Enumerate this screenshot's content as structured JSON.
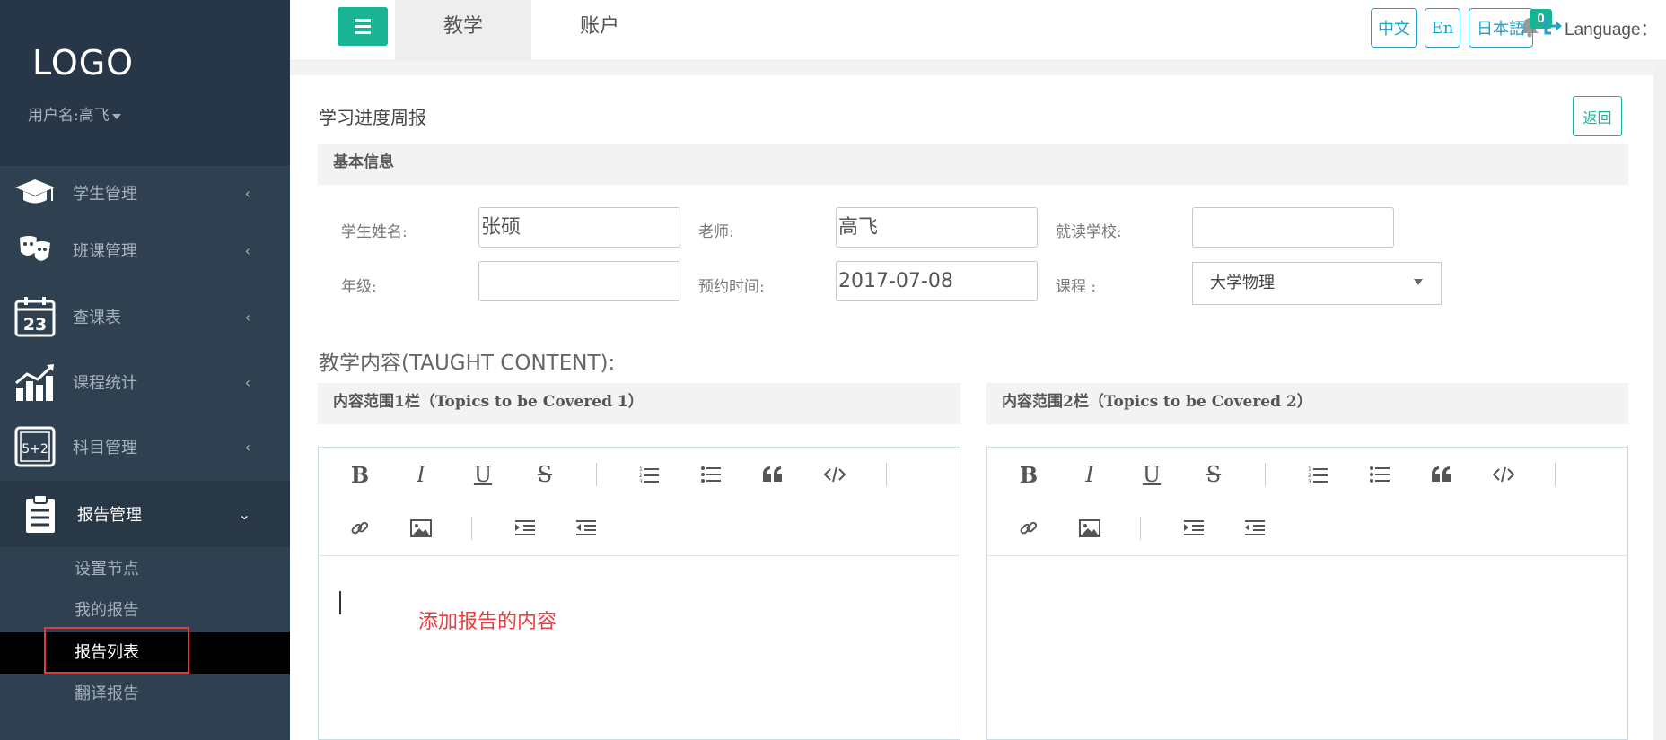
{
  "sidebar": {
    "logo": "LOGO",
    "username": "用户名:高飞",
    "items": [
      {
        "label": "学生管理",
        "icon": "graduation-cap-icon"
      },
      {
        "label": "班课管理",
        "icon": "theater-masks-icon"
      },
      {
        "label": "查课表",
        "icon": "calendar-23-icon"
      },
      {
        "label": "课程统计",
        "icon": "bar-chart-icon"
      },
      {
        "label": "科目管理",
        "icon": "chalkboard-icon"
      },
      {
        "label": "报告管理",
        "icon": "clipboard-icon"
      }
    ],
    "subitems": [
      {
        "label": "设置节点"
      },
      {
        "label": "我的报告"
      },
      {
        "label": "报告列表"
      },
      {
        "label": "翻译报告"
      }
    ]
  },
  "topbar": {
    "tabs": [
      {
        "label": "教学"
      },
      {
        "label": "账户"
      }
    ],
    "notification_count": "0",
    "language_label": "Language：",
    "languages": [
      {
        "label": "中文"
      },
      {
        "label": "En"
      },
      {
        "label": "日本語"
      }
    ]
  },
  "page": {
    "title": "学习进度周报",
    "back_label": "返回",
    "basic_info_title": "基本信息",
    "fields": {
      "student_name_label": "学生姓名:",
      "student_name_value": "张硕",
      "teacher_label": "老师:",
      "teacher_value": "高飞",
      "school_label": "就读学校:",
      "school_value": "",
      "grade_label": "年级:",
      "grade_value": "",
      "booking_time_label": "预约时间:",
      "booking_time_value": "2017-07-08",
      "course_label": "课程 :",
      "course_value": "大学物理"
    },
    "taught_content_heading": "教学内容(TAUGHT CONTENT):",
    "topics1_title": "内容范围1栏（Topics to be Covered 1）",
    "topics2_title": "内容范围2栏（Topics to be Covered 2）",
    "editor1_annotation": "添加报告的内容",
    "toolbar": {
      "bold": "B",
      "italic": "I",
      "underline": "U",
      "strike": "S"
    }
  },
  "colors": {
    "accent": "#1ab394",
    "sidebar_bg": "#2f4050",
    "lang_blue": "#23a2c7",
    "highlight_red": "#e03c3c"
  }
}
